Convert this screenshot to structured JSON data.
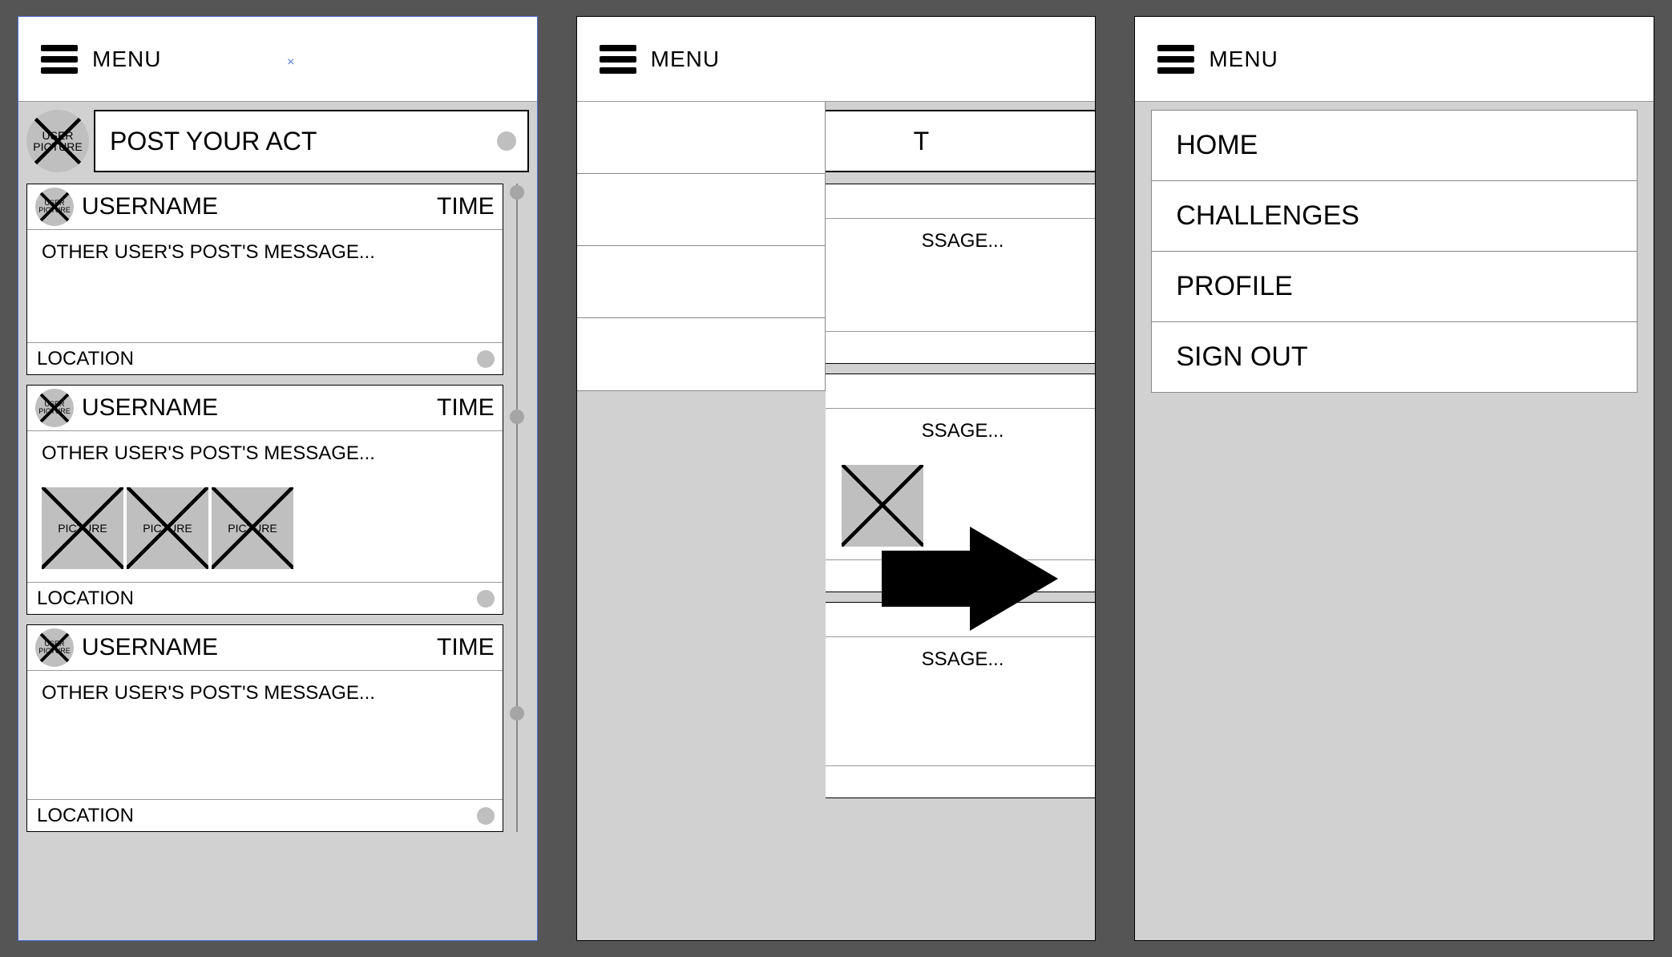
{
  "header": {
    "menu_label": "MENU"
  },
  "composer": {
    "avatar_label": "USER\nPICTURE",
    "placeholder": "POST YOUR ACT",
    "truncated": "T"
  },
  "post": {
    "avatar_label": "USER\nPICTURE",
    "username": "USERNAME",
    "time": "TIME",
    "message": "OTHER USER'S POST'S MESSAGE...",
    "message_trunc": "SSAGE...",
    "location": "LOCATION",
    "pic_label": "PICTURE"
  },
  "menu": {
    "items": [
      "HOME",
      "CHALLENGES",
      "PROFILE",
      "SIGN OUT"
    ]
  },
  "close_glyph": "×"
}
